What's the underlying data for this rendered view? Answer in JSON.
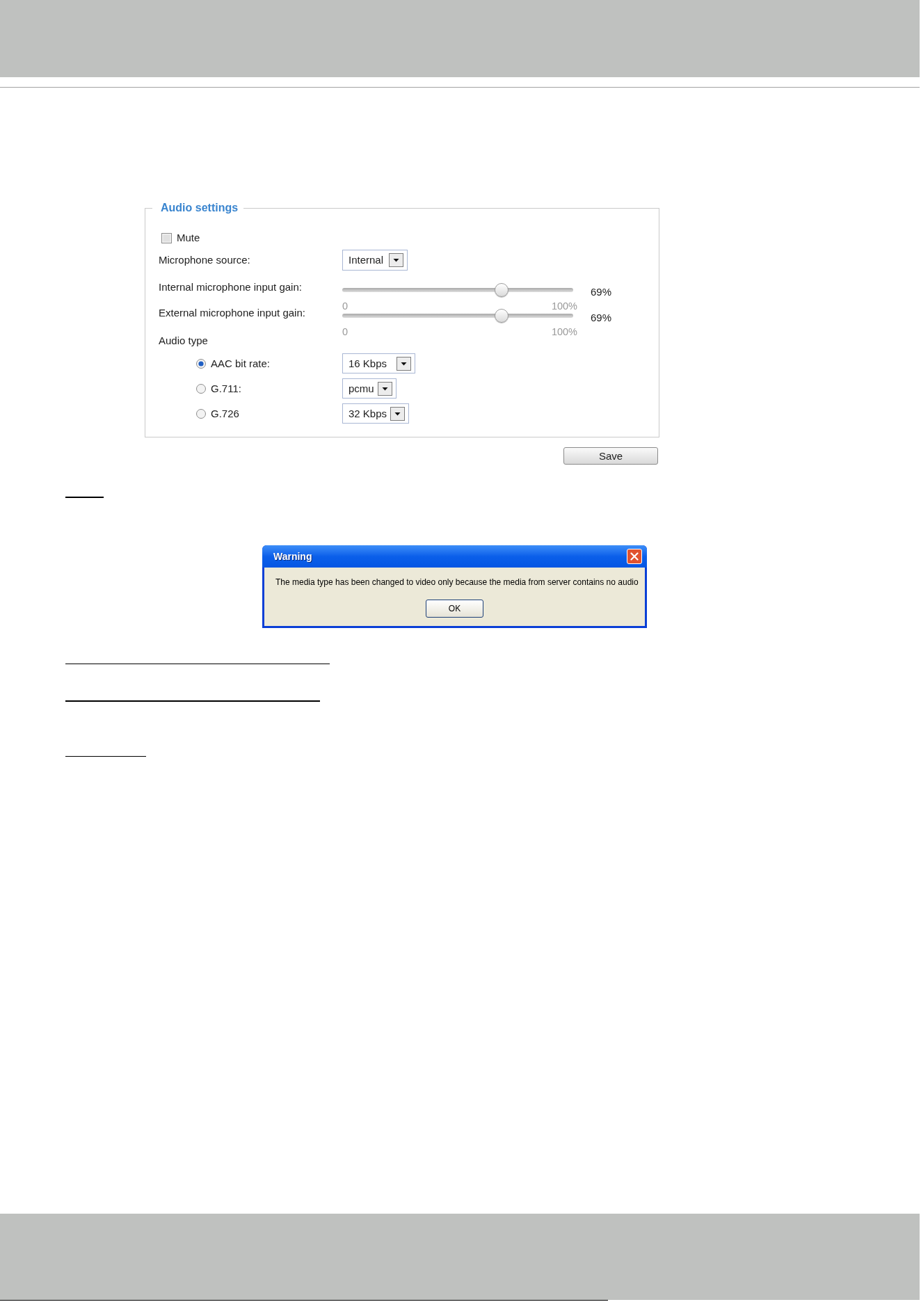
{
  "audio_settings": {
    "title": "Audio settings",
    "mute": {
      "label": "Mute",
      "checked": false
    },
    "microphone_source": {
      "label": "Microphone source:",
      "value": "Internal"
    },
    "gains": [
      {
        "label": "Internal microphone input gain:",
        "level": 0.69,
        "reading": "69%",
        "min_label": "0",
        "max_label": "100%"
      },
      {
        "label": "External microphone input gain:",
        "level": 0.69,
        "reading": "69%",
        "min_label": "0",
        "max_label": "100%"
      }
    ],
    "audio_type": {
      "label": "Audio type",
      "options": [
        {
          "label": "AAC bit rate:",
          "selected": true,
          "value": "16 Kbps"
        },
        {
          "label": "G.711:",
          "selected": false,
          "value": "pcmu"
        },
        {
          "label": "G.726",
          "selected": false,
          "value": "32 Kbps"
        }
      ]
    }
  },
  "save_button": "Save",
  "warning_dialog": {
    "title": "Warning",
    "message": "The media type has been changed to video only because the media from server contains no audio",
    "button": "OK"
  }
}
